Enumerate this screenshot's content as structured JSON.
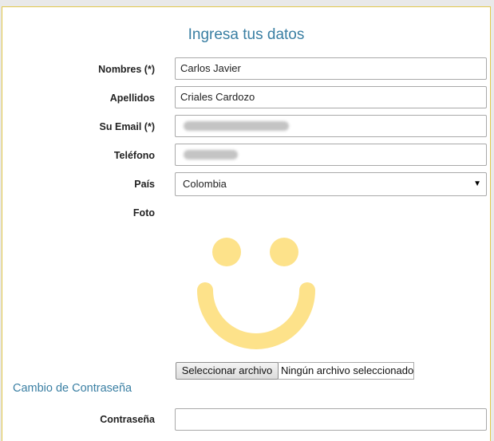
{
  "form": {
    "title": "Ingresa tus datos",
    "fields": {
      "nombres": {
        "label": "Nombres (*)",
        "value": "Carlos Javier"
      },
      "apellidos": {
        "label": "Apellidos",
        "value": "Criales Cardozo"
      },
      "email": {
        "label": "Su Email (*)",
        "value": ""
      },
      "telefono": {
        "label": "Teléfono",
        "value": ""
      },
      "pais": {
        "label": "País",
        "value": "Colombia"
      },
      "foto": {
        "label": "Foto"
      }
    },
    "file_input": {
      "button_label": "Seleccionar archivo",
      "status": "Ningún archivo seleccionado"
    },
    "password_section": {
      "link": "Cambio de Contraseña",
      "password_label": "Contraseña",
      "password_value": ""
    }
  },
  "colors": {
    "accent": "#3a7fa3",
    "panel_border": "#e3c84a",
    "smiley": "#fde28a"
  },
  "icons": {
    "photo_placeholder": "smiley-face-icon",
    "select_arrow": "triangle-down-icon"
  }
}
